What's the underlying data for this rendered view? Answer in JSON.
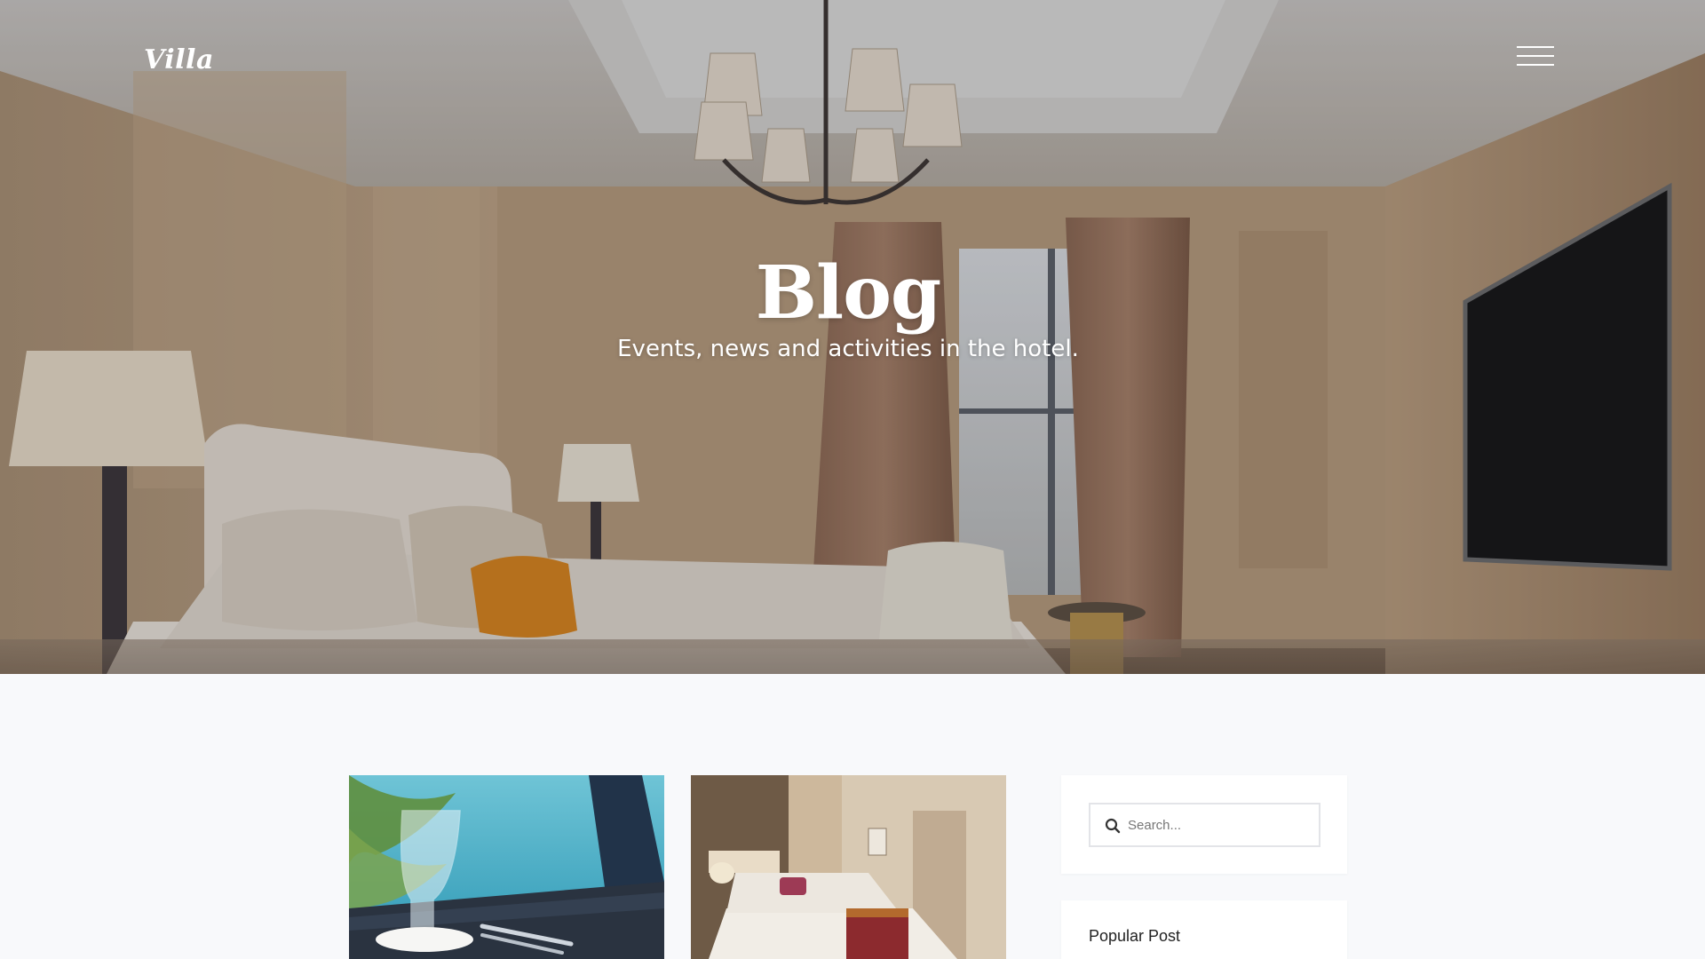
{
  "header": {
    "logo_text": "Villa",
    "menu_icon": "hamburger-menu-icon"
  },
  "hero": {
    "title": "Blog",
    "subtitle": "Events, news and activities in the hotel."
  },
  "blog": {
    "cards": [
      {
        "image": "beach-dining-table-photo"
      },
      {
        "image": "hotel-bedroom-photo"
      }
    ]
  },
  "sidebar": {
    "search": {
      "placeholder": "Search...",
      "icon": "search-icon"
    },
    "popular_post": {
      "title": "Popular Post"
    }
  },
  "colors": {
    "page_background": "#f8f9fb",
    "widget_background": "#ffffff",
    "hero_text": "#ffffff"
  }
}
